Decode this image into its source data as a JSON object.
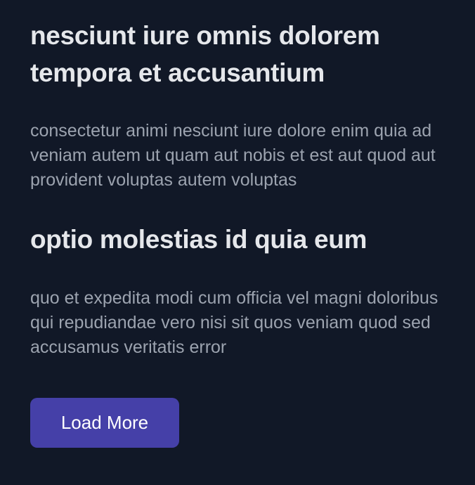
{
  "posts": [
    {
      "title": "nesciunt iure omnis dolorem tempora et accusantium",
      "body": "consectetur animi nesciunt iure dolore enim quia ad veniam autem ut quam aut nobis et est aut quod aut provident voluptas autem voluptas"
    },
    {
      "title": "optio molestias id quia eum",
      "body": "quo et expedita modi cum officia vel magni doloribus qui repudiandae vero nisi sit quos veniam quod sed accusamus veritatis error"
    }
  ],
  "actions": {
    "load_more_label": "Load More"
  },
  "colors": {
    "background": "#111827",
    "title": "#e5e7eb",
    "body": "#9ca3af",
    "button": "#4540a8"
  }
}
